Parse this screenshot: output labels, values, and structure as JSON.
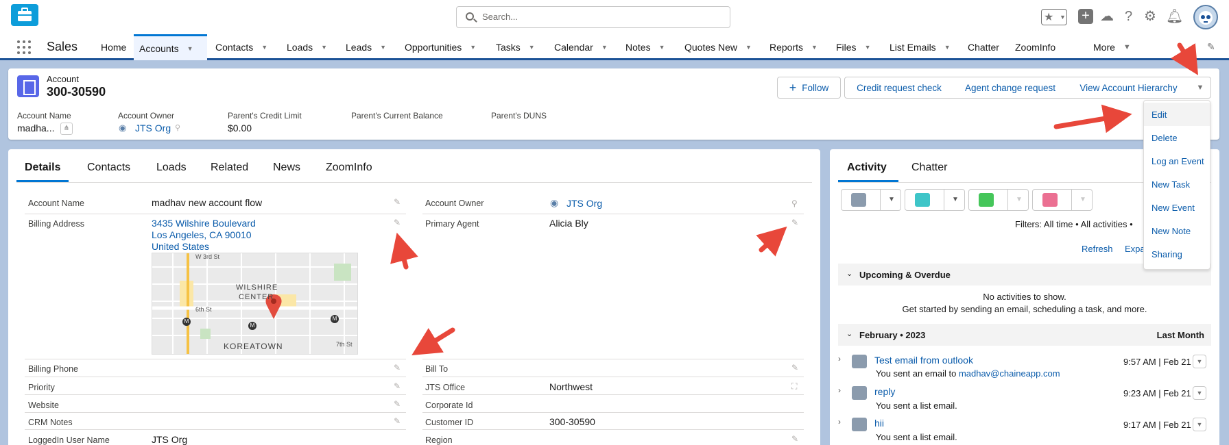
{
  "search": {
    "placeholder": "Search..."
  },
  "app": {
    "name": "Sales"
  },
  "nav": {
    "home": "Home",
    "accounts": "Accounts",
    "contacts": "Contacts",
    "loads": "Loads",
    "leads": "Leads",
    "opportunities": "Opportunities",
    "tasks": "Tasks",
    "calendar": "Calendar",
    "notes": "Notes",
    "quotes": "Quotes New",
    "reports": "Reports",
    "files": "Files",
    "list_emails": "List Emails",
    "chatter": "Chatter",
    "zoominfo": "ZoomInfo",
    "more": "More"
  },
  "record": {
    "type": "Account",
    "number": "300-30590",
    "buttons": {
      "follow": "Follow",
      "credit": "Credit request check",
      "agent": "Agent change request",
      "hierarchy": "View Account Hierarchy"
    },
    "highlights": {
      "account_name_label": "Account Name",
      "account_name_value": "madha...",
      "owner_label": "Account Owner",
      "owner_value": "JTS Org",
      "credit_limit_label": "Parent's Credit Limit",
      "credit_limit_value": "$0.00",
      "balance_label": "Parent's Current Balance",
      "duns_label": "Parent's DUNS"
    }
  },
  "menu": [
    "Edit",
    "Delete",
    "Log an Event",
    "New Task",
    "New Event",
    "New Note",
    "Sharing"
  ],
  "tabs": [
    "Details",
    "Contacts",
    "Loads",
    "Related",
    "News",
    "ZoomInfo"
  ],
  "details": {
    "account_name_label": "Account Name",
    "account_name": "madhav new account flow",
    "billing_address_label": "Billing Address",
    "address_line1": "3435 Wilshire Boulevard",
    "address_line2": "Los Angeles, CA 90010",
    "address_line3": "United States",
    "owner_label": "Account Owner",
    "owner": "JTS Org",
    "primary_agent_label": "Primary Agent",
    "primary_agent": "Alicia Bly",
    "billing_phone_label": "Billing Phone",
    "priority_label": "Priority",
    "website_label": "Website",
    "crm_notes_label": "CRM Notes",
    "loggedin_label": "LoggedIn User Name",
    "loggedin": "JTS Org",
    "bill_to_label": "Bill To",
    "jts_office_label": "JTS Office",
    "jts_office": "Northwest",
    "corporate_id_label": "Corporate Id",
    "customer_id_label": "Customer ID",
    "customer_id": "300-30590",
    "region_label": "Region"
  },
  "map": {
    "w3rd": "W 3rd St",
    "wilshire": "WILSHIRE",
    "center": "CENTER",
    "sixth": "6th St",
    "koreatown": "KOREATOWN",
    "seventh": "7th St",
    "metro": "M"
  },
  "activity": {
    "tabs": [
      "Activity",
      "Chatter"
    ],
    "filters": "Filters: All time • All activities •",
    "refresh": "Refresh",
    "expand": "Expa",
    "upcoming": "Upcoming & Overdue",
    "no_activities": "No activities to show.",
    "get_started": "Get started by sending an email, scheduling a task, and more.",
    "month": "February • 2023",
    "last_month": "Last Month",
    "items": [
      {
        "title": "Test email from outlook",
        "time": "9:57 AM | Feb 21",
        "sub": "You sent an email to ",
        "link": "madhav@chaineapp.com"
      },
      {
        "title": "reply",
        "time": "9:23 AM | Feb 21",
        "sub": "You sent a list email."
      },
      {
        "title": "hii",
        "time": "9:17 AM | Feb 21",
        "sub": "You sent a list email."
      }
    ]
  },
  "colors": {
    "accent": "#0176d3",
    "link": "#0b5cab",
    "arrow": "#e8473a",
    "account_icon": "#5867e8"
  }
}
